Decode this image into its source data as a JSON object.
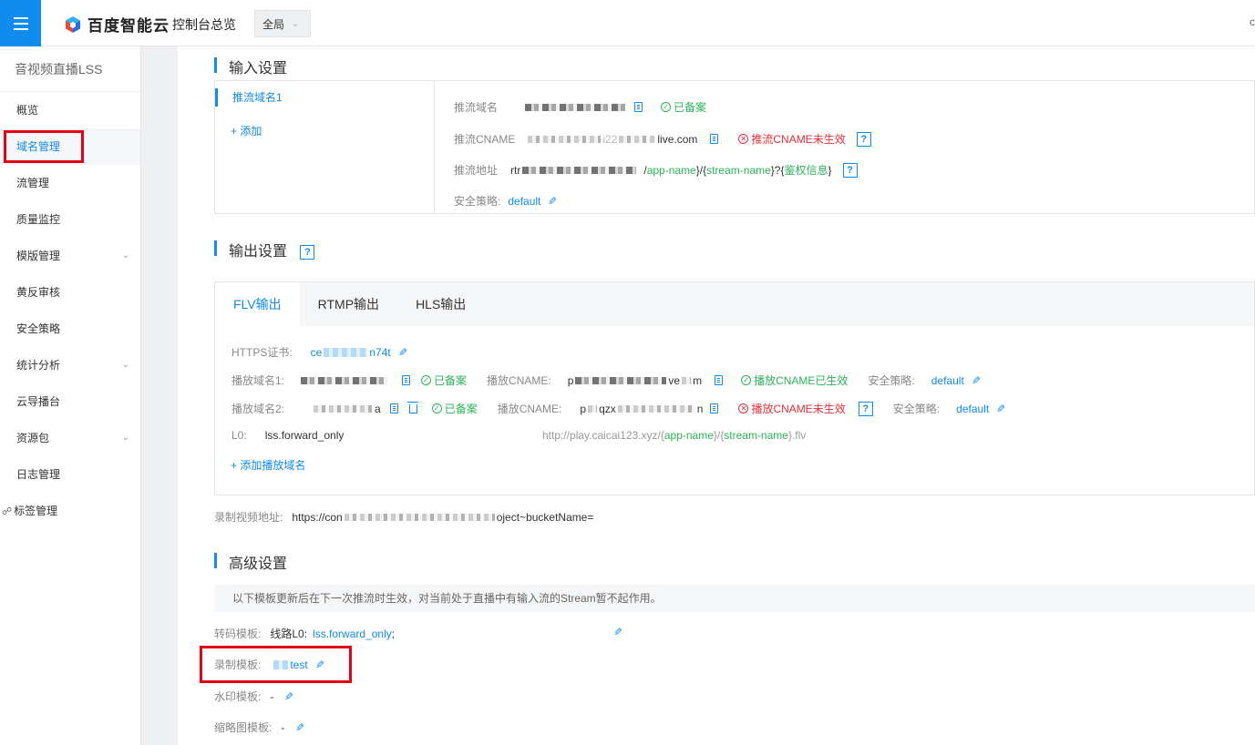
{
  "app": {
    "brand": "百度智能云",
    "console_title": "控制台总览",
    "region": "全局",
    "top_right_glyph": "c"
  },
  "sidebar": {
    "title": "音视频直播LSS",
    "items": [
      {
        "label": "概览"
      },
      {
        "label": "域名管理"
      },
      {
        "label": "流管理"
      },
      {
        "label": "质量监控"
      },
      {
        "label": "模版管理"
      },
      {
        "label": "黄反审核"
      },
      {
        "label": "安全策略"
      },
      {
        "label": "统计分析"
      },
      {
        "label": "云导播台"
      },
      {
        "label": "资源包"
      },
      {
        "label": "日志管理"
      },
      {
        "label": "标签管理"
      }
    ]
  },
  "input": {
    "title": "输入设置",
    "domain_tab": "推流域名1",
    "add_link": "+ 添加",
    "push_domain_label": "推流域名",
    "push_domain_status": "已备案",
    "cname_label": "推流CNAME",
    "cname_visible_mid": "i22",
    "cname_suffix": "live.com",
    "cname_status": "推流CNAME未生效",
    "addr_label": "推流地址",
    "addr_prefix": "rtr",
    "addr_tail_1": "/",
    "addr_app": "app-name",
    "addr_sep_1": "}/{",
    "addr_stream": "stream-name",
    "addr_sep_2": "}?{",
    "addr_auth": "鉴权信息",
    "addr_end": "}",
    "policy_label": "安全策略:",
    "policy_value": "default"
  },
  "output": {
    "title": "输出设置",
    "help": "?",
    "tabs": [
      "FLV输出",
      "RTMP输出",
      "HLS输出"
    ],
    "https_label": "HTTPS证书:",
    "https_prefix": "ce",
    "https_suffix": "n74t",
    "play1_label": "播放域名1:",
    "play1_status": "已备案",
    "play1_cname_label": "播放CNAME:",
    "play1_cname_prefix": "p",
    "play1_cname_mid": "ve",
    "play1_cname_suffix": "m",
    "play1_cname_status": "播放CNAME已生效",
    "play1_policy_label": "安全策略:",
    "play1_policy_value": "default",
    "play2_label": "播放域名2:",
    "play2_tail": "a",
    "play2_status": "已备案",
    "play2_cname_label": "播放CNAME:",
    "play2_cname_prefix": "p",
    "play2_cname_mid": "qzx",
    "play2_cname_suffix": "n",
    "play2_cname_status": "播放CNAME未生效",
    "play2_policy_label": "安全策略:",
    "play2_policy_value": "default",
    "l0_label": "L0:",
    "l0_value": "lss.forward_only",
    "l0_url_prefix": "http://play.caicai123.xyz/{",
    "l0_app": "app-name",
    "l0_sep": "}/{",
    "l0_stream": "stream-name",
    "l0_suffix": "}.flv",
    "add_play_domain": "+ 添加播放域名"
  },
  "record_url": {
    "label": "录制视频地址:",
    "prefix": "https://con",
    "suffix": "oject~bucketName="
  },
  "advanced": {
    "title": "高级设置",
    "notice": "以下模板更新后在下一次推流时生效，对当前处于直播中有输入流的Stream暂不起作用。",
    "transcode_label": "转码模板:",
    "transcode_line": "线路L0:",
    "transcode_value": "lss.forward_only",
    "transcode_sep": ";",
    "record_label": "录制模板:",
    "record_value": "test",
    "watermark_label": "水印模板:",
    "watermark_value": "-",
    "thumbnail_label": "缩略图模板:",
    "thumbnail_value": "-"
  },
  "colors": {
    "accent": "#108cee",
    "ok": "#2bb45a",
    "error": "#eb2f3a",
    "highlight_box": "#e60012"
  },
  "icons": [
    "menu-icon",
    "logo-icon",
    "chevron-down-icon",
    "copy-icon",
    "edit-icon",
    "trash-icon",
    "check-circle-icon",
    "close-circle-icon",
    "help-icon",
    "tag-icon"
  ]
}
